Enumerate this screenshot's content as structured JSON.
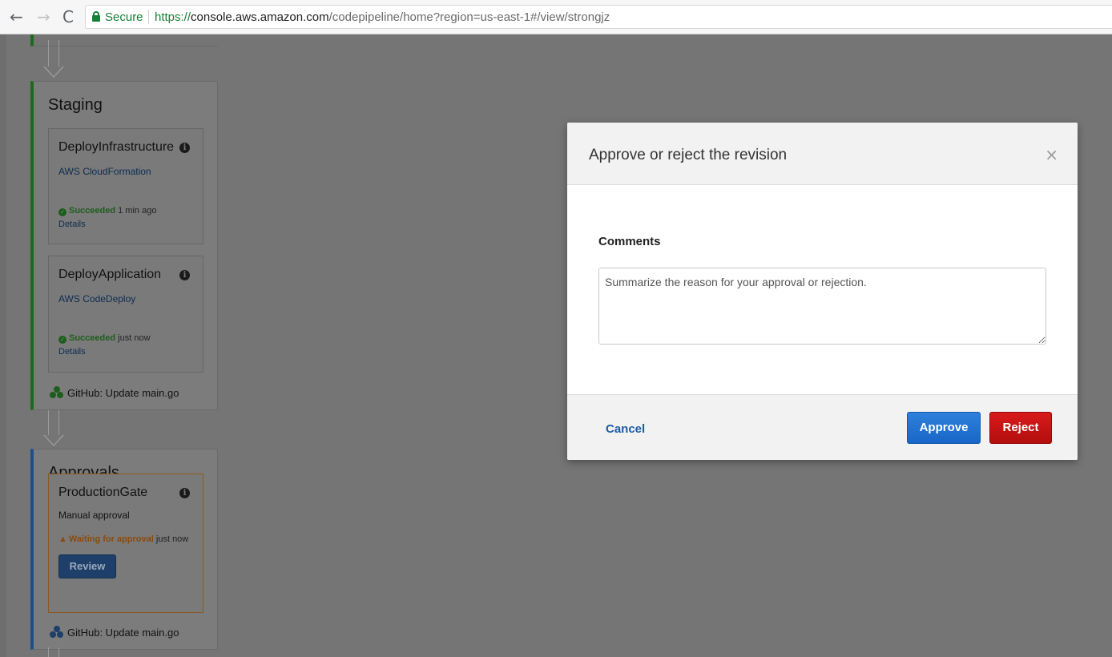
{
  "browser": {
    "back_icon": "←",
    "forward_icon": "→",
    "reload_icon": "C",
    "secure_label": "Secure",
    "url_scheme": "https://",
    "url_host": "console.aws.amazon.com",
    "url_path": "/codepipeline/home?region=us-east-1#/view/strongjz"
  },
  "pipeline": {
    "stages": [
      {
        "title": "Staging",
        "actions": [
          {
            "name": "DeployInfrastructure",
            "provider": "AWS CloudFormation",
            "status": "Succeeded",
            "time": "1 min ago",
            "details": "Details"
          },
          {
            "name": "DeployApplication",
            "provider": "AWS CodeDeploy",
            "status": "Succeeded",
            "time": "just now",
            "details": "Details"
          }
        ],
        "commit": "GitHub: Update main.go"
      },
      {
        "title": "Approvals",
        "actions": [
          {
            "name": "ProductionGate",
            "provider": "Manual approval",
            "status": "Waiting for approval",
            "time": "just now",
            "review": "Review"
          }
        ],
        "commit": "GitHub: Update main.go"
      }
    ]
  },
  "modal": {
    "title": "Approve or reject the revision",
    "close_glyph": "×",
    "comments_label": "Comments",
    "comments_placeholder": "Summarize the reason for your approval or rejection.",
    "cancel_label": "Cancel",
    "approve_label": "Approve",
    "reject_label": "Reject"
  },
  "colors": {
    "overlay": "#757575",
    "staging_accent": "#1d6a1d",
    "approvals_accent": "#1d4f8a",
    "approve": "#1867c8",
    "reject": "#b30e0e",
    "link": "#1f5aa6"
  }
}
